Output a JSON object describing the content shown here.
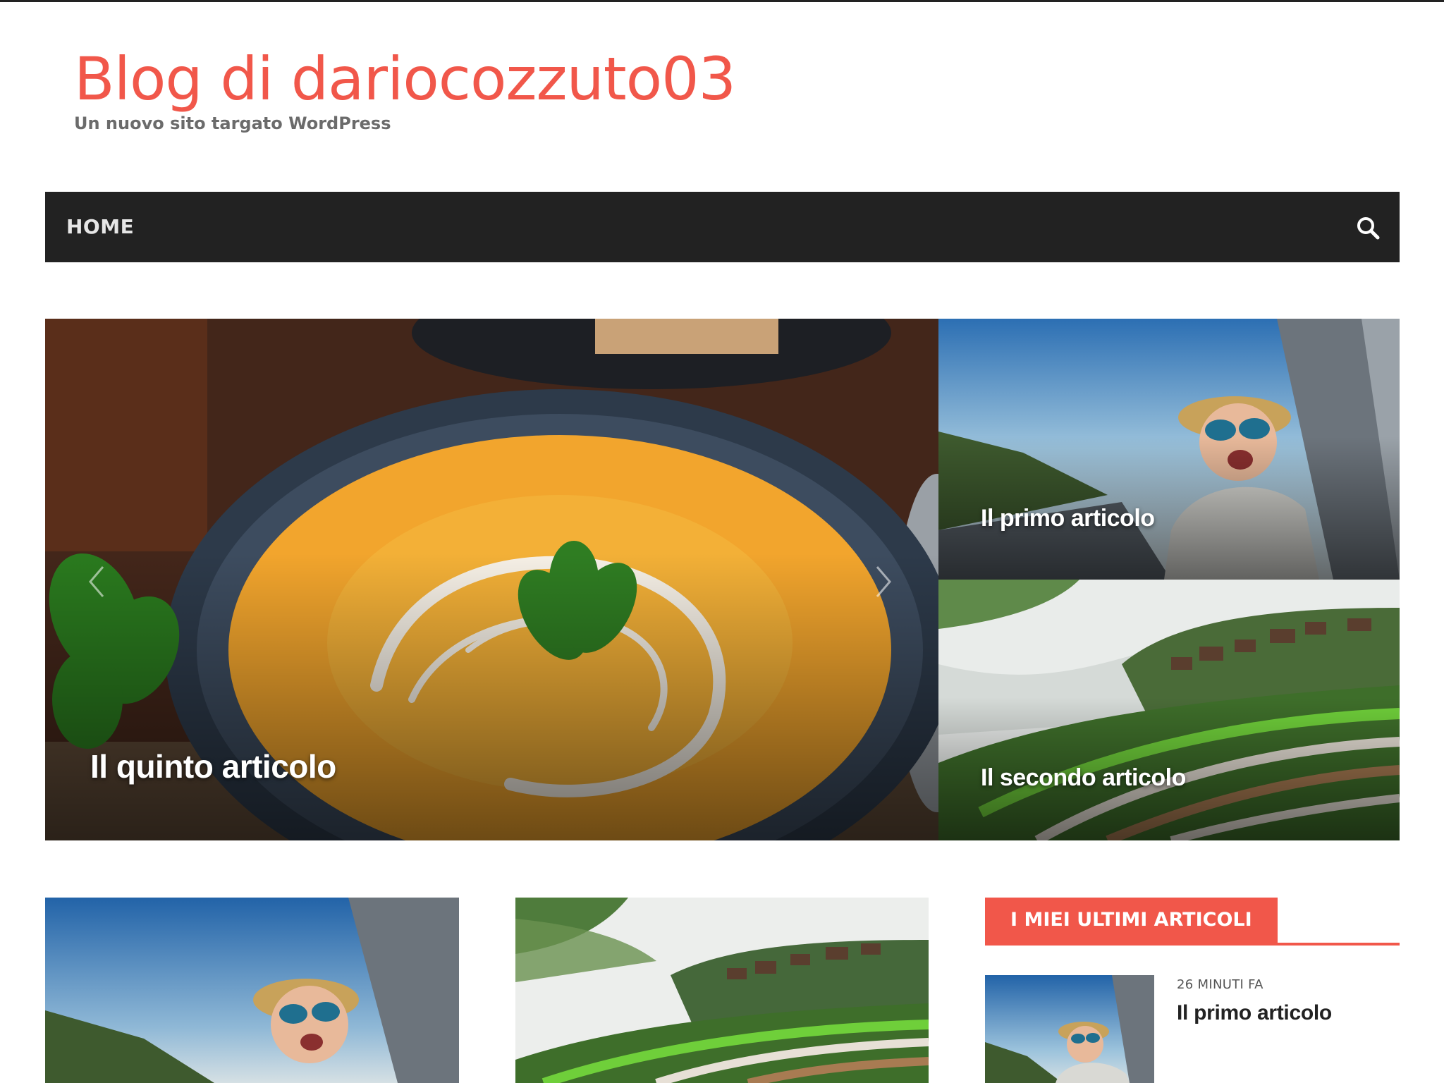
{
  "site": {
    "title": "Blog di dariocozzuto03",
    "tagline": "Un nuovo sito targato WordPress",
    "accent_color": "#f1574a"
  },
  "nav": {
    "items": [
      {
        "label": "HOME"
      }
    ],
    "search_icon": "search-icon"
  },
  "featured": {
    "main": {
      "title": "Il quinto articolo",
      "image": "pumpkin-soup-bowl"
    },
    "side": [
      {
        "title": "Il primo articolo",
        "image": "kid-in-car-window"
      },
      {
        "title": "Il secondo articolo",
        "image": "rice-terraces-fog"
      }
    ]
  },
  "posts": [
    {
      "image": "kid-in-car-window"
    },
    {
      "image": "rice-terraces-fog"
    }
  ],
  "sidebar": {
    "widget_title": "I MIEI ULTIMI ARTICOLI",
    "recent": [
      {
        "time": "26 MINUTI FA",
        "title": "Il primo articolo",
        "image": "kid-in-car-window"
      }
    ]
  }
}
